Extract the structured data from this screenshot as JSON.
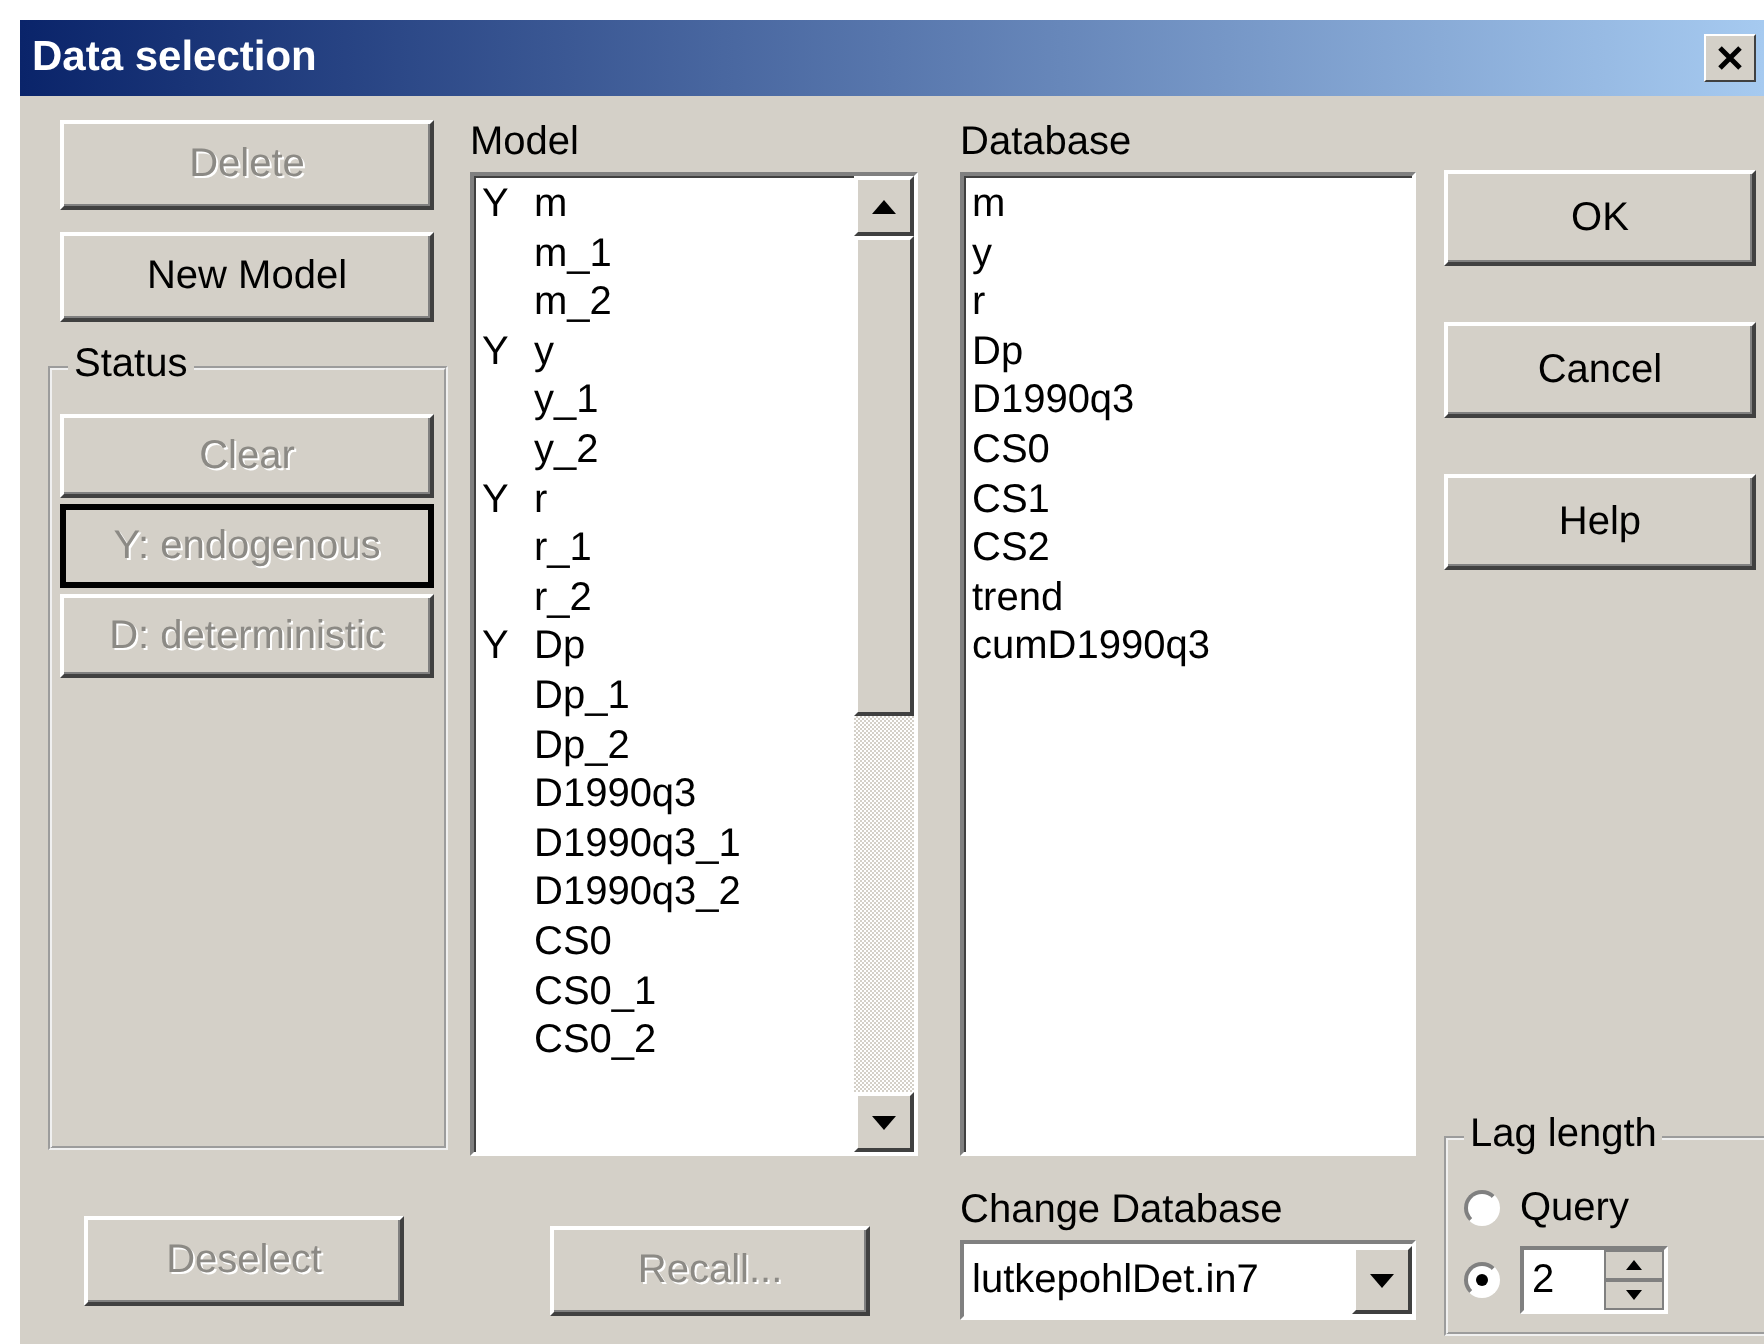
{
  "window": {
    "title": "Data selection"
  },
  "left_buttons": [
    {
      "label": "Delete",
      "disabled": true
    },
    {
      "label": "New Model",
      "disabled": false
    }
  ],
  "status": {
    "title": "Status",
    "buttons": [
      {
        "label": "Clear",
        "disabled": true,
        "focused": false
      },
      {
        "label": "Y: endogenous",
        "disabled": true,
        "focused": true
      },
      {
        "label": "D: deterministic",
        "disabled": true,
        "focused": false
      }
    ]
  },
  "model": {
    "label": "Model",
    "items": [
      {
        "flag": "Y",
        "name": "m"
      },
      {
        "name": "m_1"
      },
      {
        "name": "m_2"
      },
      {
        "flag": "Y",
        "name": "y"
      },
      {
        "name": "y_1"
      },
      {
        "name": "y_2"
      },
      {
        "flag": "Y",
        "name": "r"
      },
      {
        "name": "r_1"
      },
      {
        "name": "r_2"
      },
      {
        "flag": "Y",
        "name": "Dp"
      },
      {
        "name": "Dp_1"
      },
      {
        "name": "Dp_2"
      },
      {
        "name": "D1990q3"
      },
      {
        "name": "D1990q3_1"
      },
      {
        "name": "D1990q3_2"
      },
      {
        "name": "CS0"
      },
      {
        "name": "CS0_1"
      },
      {
        "name": "CS0_2"
      }
    ]
  },
  "database": {
    "label": "Database",
    "items": [
      "m",
      "y",
      "r",
      "Dp",
      "D1990q3",
      "CS0",
      "CS1",
      "CS2",
      "trend",
      "cumD1990q3"
    ]
  },
  "dialog_buttons": [
    {
      "label": "OK",
      "disabled": false
    },
    {
      "label": "Cancel",
      "disabled": false
    },
    {
      "label": "Help",
      "disabled": false
    }
  ],
  "bottom_buttons": [
    {
      "label": "Deselect",
      "disabled": true
    },
    {
      "label": "Recall...",
      "disabled": true
    }
  ],
  "change_database": {
    "label": "Change Database",
    "value": "lutkepohlDet.in7"
  },
  "lag_length": {
    "title": "Lag length",
    "options": [
      {
        "kind": "label",
        "label": "Query",
        "selected": false
      },
      {
        "kind": "spin",
        "value": "2",
        "selected": true
      }
    ]
  }
}
